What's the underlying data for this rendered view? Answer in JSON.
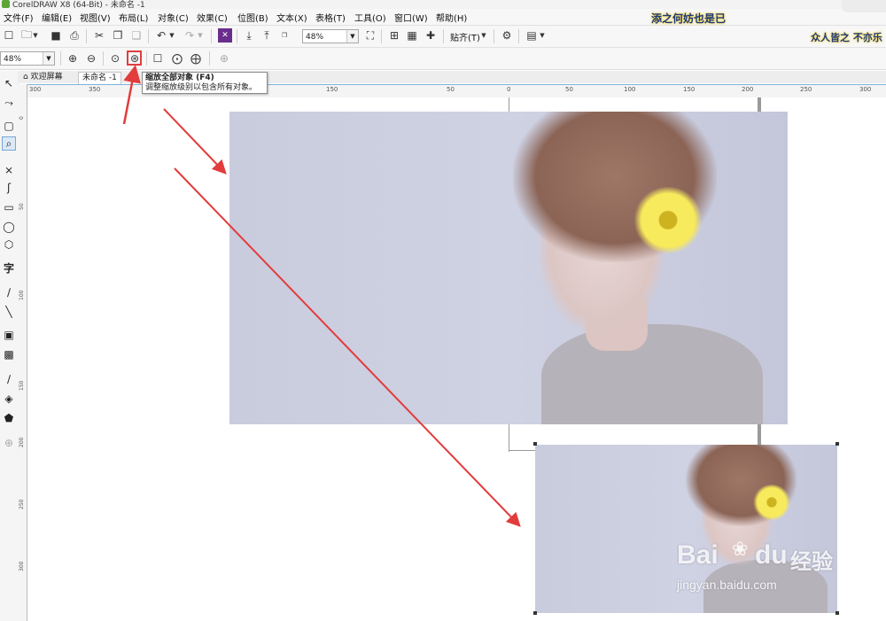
{
  "window": {
    "title": "CorelDRAW X8 (64-Bit) - 未命名 -1"
  },
  "menu": [
    "文件(F)",
    "编辑(E)",
    "视图(V)",
    "布局(L)",
    "对象(C)",
    "效果(C)",
    "位图(B)",
    "文本(X)",
    "表格(T)",
    "工具(O)",
    "窗口(W)",
    "帮助(H)"
  ],
  "banner_text": "添之何妨也是已",
  "banner_right": "众人皆之 不亦乐",
  "toolbar": {
    "zoom_combo": "48%",
    "snap_label": "贴齐(T)"
  },
  "zoombar": {
    "zoom_level": "48%"
  },
  "tabs": {
    "welcome": "欢迎屏幕",
    "document": "未命名 -1"
  },
  "tooltip": {
    "title": "缩放全部对象 (F4)",
    "desc": "调整缩放级别以包含所有对象。"
  },
  "ruler_h": [
    "300",
    "350",
    "100",
    "150",
    "50",
    "0",
    "50",
    "100",
    "150",
    "200",
    "250",
    "300"
  ],
  "ruler_v": [
    "0",
    "50",
    "100",
    "150",
    "200",
    "250",
    "300"
  ],
  "watermark": {
    "brand": "Bai",
    "brand2": "du",
    "cn": "经验",
    "url": "jingyan.baidu.com"
  },
  "colors": {
    "accent": "#5ca536",
    "arrow": "#e23c3c",
    "highlight": "#e23c3c"
  }
}
